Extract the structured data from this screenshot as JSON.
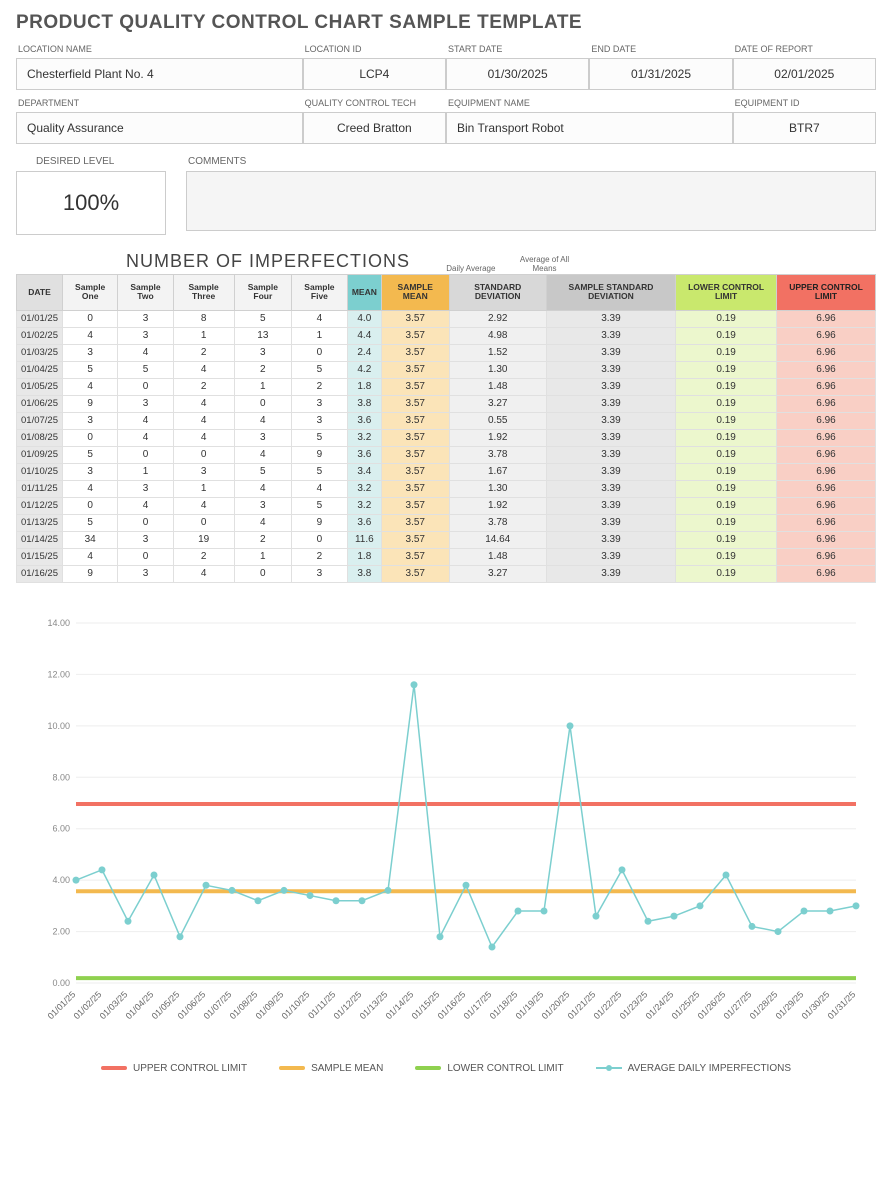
{
  "title": "PRODUCT QUALITY CONTROL CHART SAMPLE TEMPLATE",
  "header1": {
    "labels": [
      "LOCATION NAME",
      "LOCATION ID",
      "START DATE",
      "END DATE",
      "DATE OF REPORT"
    ],
    "values": [
      "Chesterfield Plant No. 4",
      "LCP4",
      "01/30/2025",
      "01/31/2025",
      "02/01/2025"
    ]
  },
  "header2": {
    "labels": [
      "DEPARTMENT",
      "QUALITY CONTROL TECH",
      "EQUIPMENT NAME",
      "EQUIPMENT ID"
    ],
    "values": [
      "Quality Assurance",
      "Creed Bratton",
      "Bin Transport Robot",
      "BTR7"
    ]
  },
  "desired": {
    "label": "DESIRED LEVEL",
    "value": "100%"
  },
  "comments_label": "COMMENTS",
  "section_title": "NUMBER OF IMPERFECTIONS",
  "mini_labels": [
    "Daily Average",
    "Average of All Means",
    "",
    "",
    "",
    ""
  ],
  "columns": [
    "DATE",
    "Sample One",
    "Sample Two",
    "Sample Three",
    "Sample Four",
    "Sample Five",
    "MEAN",
    "SAMPLE MEAN",
    "STANDARD DEVIATION",
    "SAMPLE STANDARD DEVIATION",
    "LOWER CONTROL LIMIT",
    "UPPER CONTROL LIMIT"
  ],
  "rows": [
    {
      "date": "01/01/25",
      "s": [
        0,
        3,
        8,
        5,
        4
      ],
      "mean": 4.0,
      "smean": 3.57,
      "sd": 2.92,
      "ssd": 3.39,
      "lcl": 0.19,
      "ucl": 6.96
    },
    {
      "date": "01/02/25",
      "s": [
        4,
        3,
        1,
        13,
        1
      ],
      "mean": 4.4,
      "smean": 3.57,
      "sd": 4.98,
      "ssd": 3.39,
      "lcl": 0.19,
      "ucl": 6.96
    },
    {
      "date": "01/03/25",
      "s": [
        3,
        4,
        2,
        3,
        0
      ],
      "mean": 2.4,
      "smean": 3.57,
      "sd": 1.52,
      "ssd": 3.39,
      "lcl": 0.19,
      "ucl": 6.96
    },
    {
      "date": "01/04/25",
      "s": [
        5,
        5,
        4,
        2,
        5
      ],
      "mean": 4.2,
      "smean": 3.57,
      "sd": 1.3,
      "ssd": 3.39,
      "lcl": 0.19,
      "ucl": 6.96
    },
    {
      "date": "01/05/25",
      "s": [
        4,
        0,
        2,
        1,
        2
      ],
      "mean": 1.8,
      "smean": 3.57,
      "sd": 1.48,
      "ssd": 3.39,
      "lcl": 0.19,
      "ucl": 6.96
    },
    {
      "date": "01/06/25",
      "s": [
        9,
        3,
        4,
        0,
        3
      ],
      "mean": 3.8,
      "smean": 3.57,
      "sd": 3.27,
      "ssd": 3.39,
      "lcl": 0.19,
      "ucl": 6.96
    },
    {
      "date": "01/07/25",
      "s": [
        3,
        4,
        4,
        4,
        3
      ],
      "mean": 3.6,
      "smean": 3.57,
      "sd": 0.55,
      "ssd": 3.39,
      "lcl": 0.19,
      "ucl": 6.96
    },
    {
      "date": "01/08/25",
      "s": [
        0,
        4,
        4,
        3,
        5
      ],
      "mean": 3.2,
      "smean": 3.57,
      "sd": 1.92,
      "ssd": 3.39,
      "lcl": 0.19,
      "ucl": 6.96
    },
    {
      "date": "01/09/25",
      "s": [
        5,
        0,
        0,
        4,
        9
      ],
      "mean": 3.6,
      "smean": 3.57,
      "sd": 3.78,
      "ssd": 3.39,
      "lcl": 0.19,
      "ucl": 6.96
    },
    {
      "date": "01/10/25",
      "s": [
        3,
        1,
        3,
        5,
        5
      ],
      "mean": 3.4,
      "smean": 3.57,
      "sd": 1.67,
      "ssd": 3.39,
      "lcl": 0.19,
      "ucl": 6.96
    },
    {
      "date": "01/11/25",
      "s": [
        4,
        3,
        1,
        4,
        4
      ],
      "mean": 3.2,
      "smean": 3.57,
      "sd": 1.3,
      "ssd": 3.39,
      "lcl": 0.19,
      "ucl": 6.96
    },
    {
      "date": "01/12/25",
      "s": [
        0,
        4,
        4,
        3,
        5
      ],
      "mean": 3.2,
      "smean": 3.57,
      "sd": 1.92,
      "ssd": 3.39,
      "lcl": 0.19,
      "ucl": 6.96
    },
    {
      "date": "01/13/25",
      "s": [
        5,
        0,
        0,
        4,
        9
      ],
      "mean": 3.6,
      "smean": 3.57,
      "sd": 3.78,
      "ssd": 3.39,
      "lcl": 0.19,
      "ucl": 6.96
    },
    {
      "date": "01/14/25",
      "s": [
        34,
        3,
        19,
        2,
        0
      ],
      "mean": 11.6,
      "smean": 3.57,
      "sd": 14.64,
      "ssd": 3.39,
      "lcl": 0.19,
      "ucl": 6.96
    },
    {
      "date": "01/15/25",
      "s": [
        4,
        0,
        2,
        1,
        2
      ],
      "mean": 1.8,
      "smean": 3.57,
      "sd": 1.48,
      "ssd": 3.39,
      "lcl": 0.19,
      "ucl": 6.96
    },
    {
      "date": "01/16/25",
      "s": [
        9,
        3,
        4,
        0,
        3
      ],
      "mean": 3.8,
      "smean": 3.57,
      "sd": 3.27,
      "ssd": 3.39,
      "lcl": 0.19,
      "ucl": 6.96
    }
  ],
  "chart_data": {
    "type": "line",
    "title": "",
    "xlabel": "",
    "ylabel": "",
    "ylim": [
      0.0,
      14.0
    ],
    "yticks": [
      0.0,
      2.0,
      4.0,
      6.0,
      8.0,
      10.0,
      12.0,
      14.0
    ],
    "categories": [
      "01/01/25",
      "01/02/25",
      "01/03/25",
      "01/04/25",
      "01/05/25",
      "01/06/25",
      "01/07/25",
      "01/08/25",
      "01/09/25",
      "01/10/25",
      "01/11/25",
      "01/12/25",
      "01/13/25",
      "01/14/25",
      "01/15/25",
      "01/16/25",
      "01/17/25",
      "01/18/25",
      "01/19/25",
      "01/20/25",
      "01/21/25",
      "01/22/25",
      "01/23/25",
      "01/24/25",
      "01/25/25",
      "01/26/25",
      "01/27/25",
      "01/28/25",
      "01/29/25",
      "01/30/25",
      "01/31/25"
    ],
    "series": [
      {
        "name": "UPPER CONTROL LIMIT",
        "color": "#f27163",
        "style": "line",
        "values": [
          6.96,
          6.96,
          6.96,
          6.96,
          6.96,
          6.96,
          6.96,
          6.96,
          6.96,
          6.96,
          6.96,
          6.96,
          6.96,
          6.96,
          6.96,
          6.96,
          6.96,
          6.96,
          6.96,
          6.96,
          6.96,
          6.96,
          6.96,
          6.96,
          6.96,
          6.96,
          6.96,
          6.96,
          6.96,
          6.96,
          6.96
        ]
      },
      {
        "name": "SAMPLE MEAN",
        "color": "#f3b94f",
        "style": "line",
        "values": [
          3.57,
          3.57,
          3.57,
          3.57,
          3.57,
          3.57,
          3.57,
          3.57,
          3.57,
          3.57,
          3.57,
          3.57,
          3.57,
          3.57,
          3.57,
          3.57,
          3.57,
          3.57,
          3.57,
          3.57,
          3.57,
          3.57,
          3.57,
          3.57,
          3.57,
          3.57,
          3.57,
          3.57,
          3.57,
          3.57,
          3.57
        ]
      },
      {
        "name": "LOWER CONTROL LIMIT",
        "color": "#8fd14f",
        "style": "line",
        "values": [
          0.19,
          0.19,
          0.19,
          0.19,
          0.19,
          0.19,
          0.19,
          0.19,
          0.19,
          0.19,
          0.19,
          0.19,
          0.19,
          0.19,
          0.19,
          0.19,
          0.19,
          0.19,
          0.19,
          0.19,
          0.19,
          0.19,
          0.19,
          0.19,
          0.19,
          0.19,
          0.19,
          0.19,
          0.19,
          0.19,
          0.19
        ]
      },
      {
        "name": "AVERAGE DAILY IMPERFECTIONS",
        "color": "#7ccfcf",
        "style": "line-marker",
        "values": [
          4.0,
          4.4,
          2.4,
          4.2,
          1.8,
          3.8,
          3.6,
          3.2,
          3.6,
          3.4,
          3.2,
          3.2,
          3.6,
          11.6,
          1.8,
          3.8,
          1.4,
          2.8,
          2.8,
          10.0,
          2.6,
          4.4,
          2.4,
          2.6,
          3.0,
          4.2,
          2.2,
          2.0,
          2.8,
          2.8,
          3.0
        ]
      }
    ]
  },
  "legend": [
    "UPPER CONTROL LIMIT",
    "SAMPLE MEAN",
    "LOWER CONTROL LIMIT",
    "AVERAGE DAILY IMPERFECTIONS"
  ]
}
